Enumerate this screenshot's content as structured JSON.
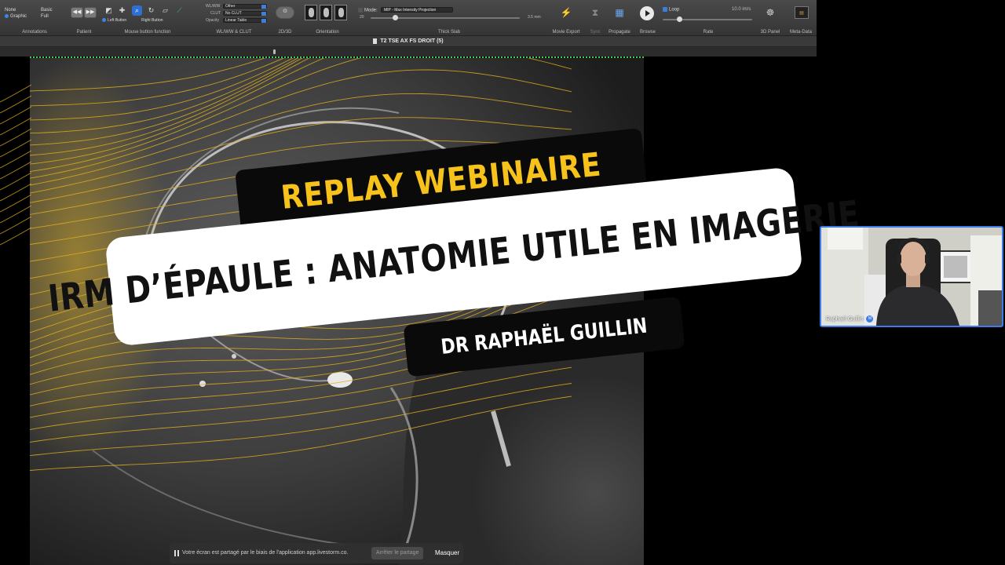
{
  "toolbar": {
    "annotations": {
      "label": "Annotations",
      "options": [
        "None",
        "Graphic",
        "Basic",
        "Full"
      ]
    },
    "patient": {
      "label": "Patient"
    },
    "mouse": {
      "label": "Mouse button function",
      "left": "Left Button",
      "right": "Right Button"
    },
    "wlww": {
      "label": "WL/WW & CLUT",
      "wlww_label": "WL/WW",
      "wlww_value": "Other",
      "clut_label": "CLUT",
      "clut_value": "No CLUT",
      "opacity_label": "Opacity",
      "opacity_value": "Linear Table"
    },
    "view2d3d": {
      "label": "2D/3D"
    },
    "orientation": {
      "label": "Orientation"
    },
    "thick_slab": {
      "label": "Thick Slab",
      "mode_label": "Mode:",
      "mode_value": "MIP - Max Intensity Projection",
      "count": "20",
      "thickness": "3.5 mm"
    },
    "movie_export": {
      "label": "Movie Export"
    },
    "sync": {
      "label": "Sync"
    },
    "propagate": {
      "label": "Propagate"
    },
    "browse": {
      "label": "Browse"
    },
    "rate": {
      "label": "Rate",
      "loop_label": "Loop",
      "value": "10.0 im/s"
    },
    "panel3d": {
      "label": "3D Panel"
    },
    "metadata": {
      "label": "Meta-Data"
    }
  },
  "series": {
    "title": "T2 TSE AX FS DROIT (5)"
  },
  "banner": {
    "replay": "REPLAY WEBINAIRE",
    "title": "IRM D’ÉPAULE : ANATOMIE UTILE EN IMAGERIE",
    "author": "DR RAPHAËL GUILLIN"
  },
  "share_bar": {
    "message": "Votre écran est partagé par le biais de l'application app.livestorm.co.",
    "stop": "Arrêter le partage",
    "hide": "Masquer"
  },
  "webcam": {
    "name": "Raphaël Guillin",
    "badge": "M"
  },
  "colors": {
    "accent": "#f7c21b",
    "selection": "#3b7ce8",
    "grid": "#3fd04f"
  }
}
